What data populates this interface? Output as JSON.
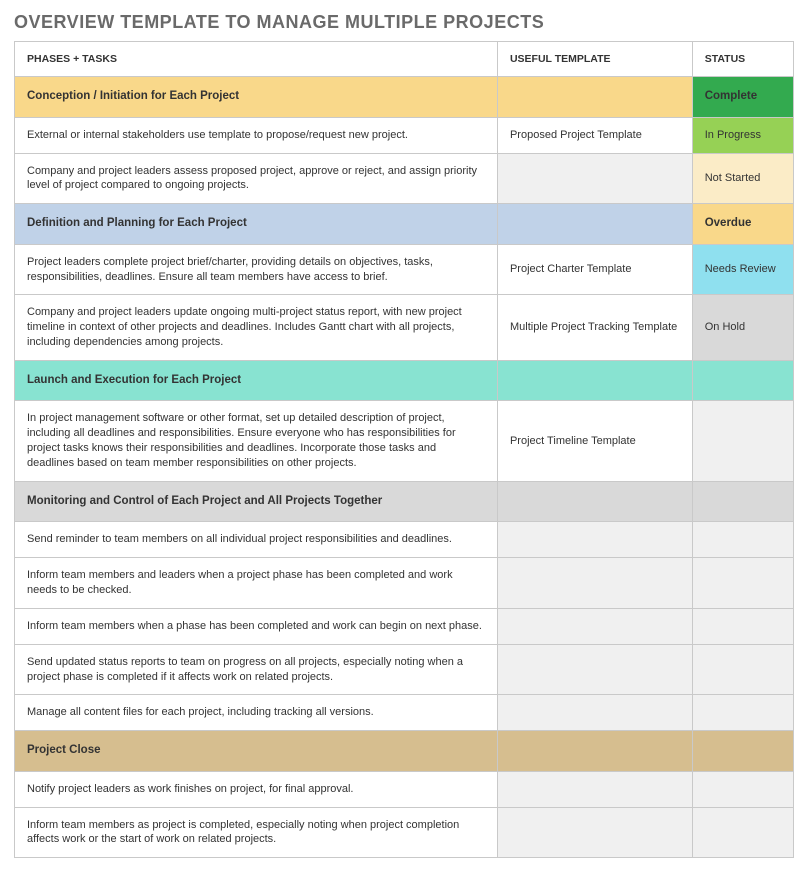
{
  "title": "OVERVIEW TEMPLATE TO MANAGE MULTIPLE PROJECTS",
  "headers": {
    "phases": "PHASES + TASKS",
    "template": "USEFUL TEMPLATE",
    "status": "STATUS"
  },
  "rows": [
    {
      "type": "phase",
      "bg": "bg-yellow",
      "task": "Conception / Initiation for Each Project",
      "template": "",
      "status": "Complete",
      "statusClass": "st-complete"
    },
    {
      "type": "task",
      "task": "External or internal stakeholders use template to propose/request new project.",
      "template": "Proposed Project Template",
      "status": "In Progress",
      "statusClass": "st-inprogress"
    },
    {
      "type": "task",
      "task": "Company and project leaders assess proposed project, approve or reject,  and assign priority level of project compared to ongoing projects.",
      "template": "",
      "status": "Not Started",
      "statusClass": "st-notstarted"
    },
    {
      "type": "phase",
      "bg": "bg-blue",
      "task": "Definition and Planning for Each Project",
      "template": "",
      "status": "Overdue",
      "statusClass": "st-overdue"
    },
    {
      "type": "task",
      "task": "Project leaders complete project brief/charter, providing details on objectives, tasks, responsibilities, deadlines. Ensure all team members have access to brief.",
      "template": "Project Charter Template",
      "status": "Needs Review",
      "statusClass": "st-review"
    },
    {
      "type": "task",
      "task": "Company and project leaders update ongoing multi-project status report, with new project timeline in context of other projects and deadlines. Includes Gantt chart with all projects, including dependencies among projects.",
      "template": "Multiple Project Tracking Template",
      "status": "On Hold",
      "statusClass": "st-onhold"
    },
    {
      "type": "phase",
      "bg": "bg-teal",
      "task": "Launch and Execution for Each Project",
      "template": "",
      "status": "",
      "statusClass": "bg-teal"
    },
    {
      "type": "task",
      "task": "In project management software or other format, set up detailed description of project, including all deadlines and responsibilities. Ensure everyone who has responsibilities for project tasks knows their responsibilities and deadlines. Incorporate those tasks and deadlines based on team member responsibilities on other projects.",
      "template": "Project Timeline Template",
      "status": "",
      "statusClass": ""
    },
    {
      "type": "phase",
      "bg": "bg-gray",
      "task": "Monitoring and Control of Each Project and All Projects Together",
      "template": "",
      "status": "",
      "statusClass": "bg-gray"
    },
    {
      "type": "task",
      "task": "Send reminder to team members on all individual project responsibilities and deadlines.",
      "template": "",
      "status": "",
      "statusClass": ""
    },
    {
      "type": "task",
      "task": "Inform team members and leaders when a project phase has been completed and work needs to be checked.",
      "template": "",
      "status": "",
      "statusClass": ""
    },
    {
      "type": "task",
      "task": "Inform team members when a phase has been completed and work can begin on next phase.",
      "template": "",
      "status": "",
      "statusClass": ""
    },
    {
      "type": "task",
      "task": "Send updated status reports to team on progress on all projects, especially noting when a project phase is completed if it affects work on related projects.",
      "template": "",
      "status": "",
      "statusClass": ""
    },
    {
      "type": "task",
      "task": "Manage all content files for each project, including tracking all versions.",
      "template": "",
      "status": "",
      "statusClass": ""
    },
    {
      "type": "phase",
      "bg": "bg-tan",
      "task": "Project Close",
      "template": "",
      "status": "",
      "statusClass": "bg-tan"
    },
    {
      "type": "task",
      "task": "Notify project leaders as work finishes on project, for final approval.",
      "template": "",
      "status": "",
      "statusClass": ""
    },
    {
      "type": "task",
      "task": "Inform team members as project is completed, especially noting when project completion affects work or the start of work on related projects.",
      "template": "",
      "status": "",
      "statusClass": ""
    }
  ]
}
